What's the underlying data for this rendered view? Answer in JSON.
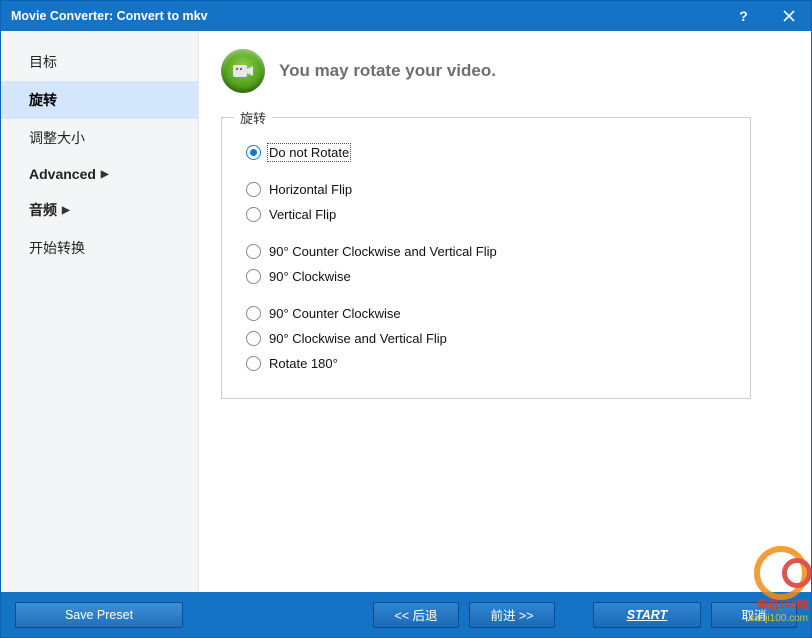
{
  "titlebar": {
    "title": "Movie Converter:  Convert to mkv"
  },
  "sidebar": {
    "items": [
      {
        "label": "目标",
        "active": false,
        "bold": false,
        "expandable": false
      },
      {
        "label": "旋转",
        "active": true,
        "bold": true,
        "expandable": false
      },
      {
        "label": "调整大小",
        "active": false,
        "bold": false,
        "expandable": false
      },
      {
        "label": "Advanced",
        "active": false,
        "bold": true,
        "expandable": true
      },
      {
        "label": "音频",
        "active": false,
        "bold": true,
        "expandable": true
      },
      {
        "label": "开始转换",
        "active": false,
        "bold": false,
        "expandable": false
      }
    ]
  },
  "main": {
    "heading": "You may rotate your video.",
    "group_title": "旋转",
    "options": [
      {
        "label": "Do not Rotate",
        "selected": true
      },
      {
        "label": "Horizontal Flip",
        "selected": false
      },
      {
        "label": "Vertical Flip",
        "selected": false
      },
      {
        "label": "90° Counter Clockwise and Vertical Flip",
        "selected": false
      },
      {
        "label": "90° Clockwise",
        "selected": false
      },
      {
        "label": "90° Counter Clockwise",
        "selected": false
      },
      {
        "label": "90° Clockwise and Vertical Flip",
        "selected": false
      },
      {
        "label": "Rotate 180°",
        "selected": false
      }
    ]
  },
  "footer": {
    "save_preset": "Save Preset",
    "back": "<<  后退",
    "forward": "前进  >>",
    "start": "START",
    "cancel": "取消"
  },
  "watermark": {
    "brand": "单机100网",
    "url": "danji100.com"
  }
}
